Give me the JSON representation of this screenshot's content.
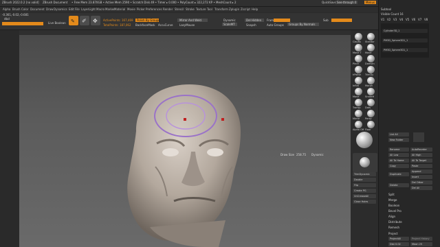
{
  "titlebar": {
    "app": "ZBrush 2022.0.2 [no valid]",
    "doc": "ZBrush Document",
    "stats": "• Free Mem 23.870GB • Active Mem 2590 • Scratch Disk 49 • Timer ▸ 0.000 • PolyCount ▸ 322,272 KP • MeshCount ▸ 2",
    "quicksave": "QuickSave",
    "see_through": "See-through 0",
    "menus": "Menus",
    "default_script": "DefaultZScript"
  },
  "menubar": {
    "items": [
      "Alpha",
      "Brush",
      "Color",
      "Document",
      "Draw",
      "Dynamics",
      "Edit",
      "File",
      "Layer",
      "Light",
      "Macro",
      "Marker",
      "Material",
      "Movie",
      "Picker",
      "Preferences",
      "Render",
      "Stencil",
      "Stroke",
      "Texture",
      "Tool",
      "Transform",
      "Zplugin",
      "Zscript",
      "Help"
    ]
  },
  "coords": "-0.361,-0.02,-0.681",
  "toolbar": {
    "brush_label": "dbcl",
    "live_boolean": "Live Boolean",
    "edit_label": "Edit",
    "draw_label": "Draw",
    "active_points": "ActivePoints: 167,469",
    "total_points": "TotalPoints: 187,062",
    "polish_by_groups": "Polish By Groups",
    "backface_mask": "BackfaceMask",
    "accucurve": "AccuCurve",
    "mirror_and_weld": "Mirror And Weld",
    "lazymouse": "LazyMouse",
    "dynamic": "Dynamic",
    "scale_mt": "ScaleMT",
    "del_hidden": "Del Hidden",
    "snapshot": "Snapsh",
    "frame": "Frame",
    "auto_groups": "Auto Groups",
    "groups_by_normals": "Groups By Normals",
    "polygroups_label": "Sub"
  },
  "right_tools": [
    {
      "label": "ClayBu"
    },
    {
      "label": "Standar"
    },
    {
      "label": "Move T"
    },
    {
      "label": "Move"
    },
    {
      "label": "Pinch"
    },
    {
      "label": "Damstn"
    },
    {
      "label": "hPolish"
    },
    {
      "label": "TrimDy"
    },
    {
      "label": "Inflat"
    },
    {
      "label": "Morph"
    },
    {
      "label": "Move"
    },
    {
      "label": "SnakeH"
    },
    {
      "label": "Transp"
    },
    {
      "label": "Dots"
    },
    {
      "label": "Mirror"
    },
    {
      "label": "Persp"
    },
    {
      "label": "Alpha Off"
    },
    {
      "label": "Floor"
    }
  ],
  "canvas": {
    "draw_size_label": "Draw Size",
    "draw_size_value": "258.75",
    "dynamic_label": "Dynamic"
  },
  "panel": {
    "header": "Subtool",
    "visible_count": "Visible Count 16",
    "version_tabs": [
      "V1",
      "V2",
      "V3",
      "V4",
      "V5",
      "V6",
      "V7",
      "V8"
    ],
    "subtools": [
      "Cylinder3D_1",
      "PM3D_Sphere3D1_1",
      "PM3D_Sphere3D1_1"
    ],
    "buttons_left": [
      "List All",
      "New Folder"
    ],
    "rename": "Rename",
    "autoreorder": "AutoReorder",
    "all_low": "All Low",
    "all_high": "All High",
    "all_to_home": "All To Home",
    "all_to_target": "All To Target",
    "copy": "Copy",
    "paste": "Paste",
    "duplicate": "Duplicate",
    "append": "Append",
    "insert": "Insert",
    "delete": "Delete",
    "del_other": "Del Other",
    "del_all": "Del All",
    "split": "Split",
    "merge": "Merge",
    "boolean": "Boolean",
    "bevel_pro": "Bevel Pro",
    "align": "Align",
    "distribute": "Distribute",
    "remesh": "Remesh",
    "project": "Project",
    "project_all": "ProjectAll",
    "project_history": "Project History",
    "dist": "Dist 0.02",
    "mean": "Mean 25",
    "left_list": [
      "TrimDynamic",
      "Double",
      "Flip",
      "Create PG",
      "UnCreaseAll",
      "Close Holes"
    ]
  },
  "colors": {
    "accent_orange": "#e38a1b",
    "canvas_bg": "#555555",
    "brush_ring": "#9a72c8"
  },
  "icons": {
    "draw": "brush-draw-icon",
    "edit": "edit-icon",
    "move": "move-gizmo-icon"
  }
}
